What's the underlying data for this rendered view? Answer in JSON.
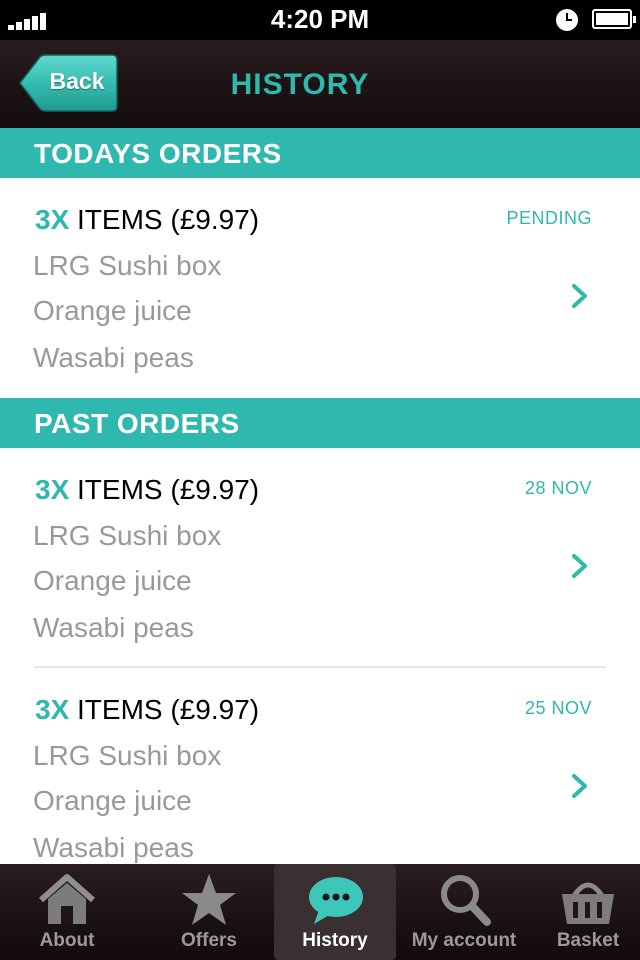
{
  "status_bar": {
    "time": "4:20 PM"
  },
  "nav": {
    "back_label": "Back",
    "title": "HISTORY"
  },
  "sections": {
    "today": {
      "header": "TODAYS ORDERS",
      "orders": [
        {
          "qty": "3X",
          "summary": " ITEMS (£9.97)",
          "status": "PENDING",
          "items": [
            "LRG Sushi box",
            "Orange juice",
            "Wasabi peas"
          ]
        }
      ]
    },
    "past": {
      "header": "PAST ORDERS",
      "orders": [
        {
          "qty": "3X",
          "summary": " ITEMS (£9.97)",
          "status": "28 NOV",
          "items": [
            "LRG Sushi box",
            "Orange juice",
            "Wasabi peas"
          ]
        },
        {
          "qty": "3X",
          "summary": " ITEMS (£9.97)",
          "status": "25 NOV",
          "items": [
            "LRG Sushi box",
            "Orange juice",
            "Wasabi peas"
          ]
        }
      ]
    }
  },
  "tabs": [
    {
      "label": "About",
      "icon": "home-icon"
    },
    {
      "label": "Offers",
      "icon": "star-icon"
    },
    {
      "label": "History",
      "icon": "chat-bubble-icon",
      "active": true
    },
    {
      "label": "My account",
      "icon": "search-icon"
    },
    {
      "label": "Basket",
      "icon": "basket-icon"
    }
  ],
  "colors": {
    "accent": "#2fb8ad",
    "muted_text": "#999999",
    "nav_background": "#1d1315"
  }
}
